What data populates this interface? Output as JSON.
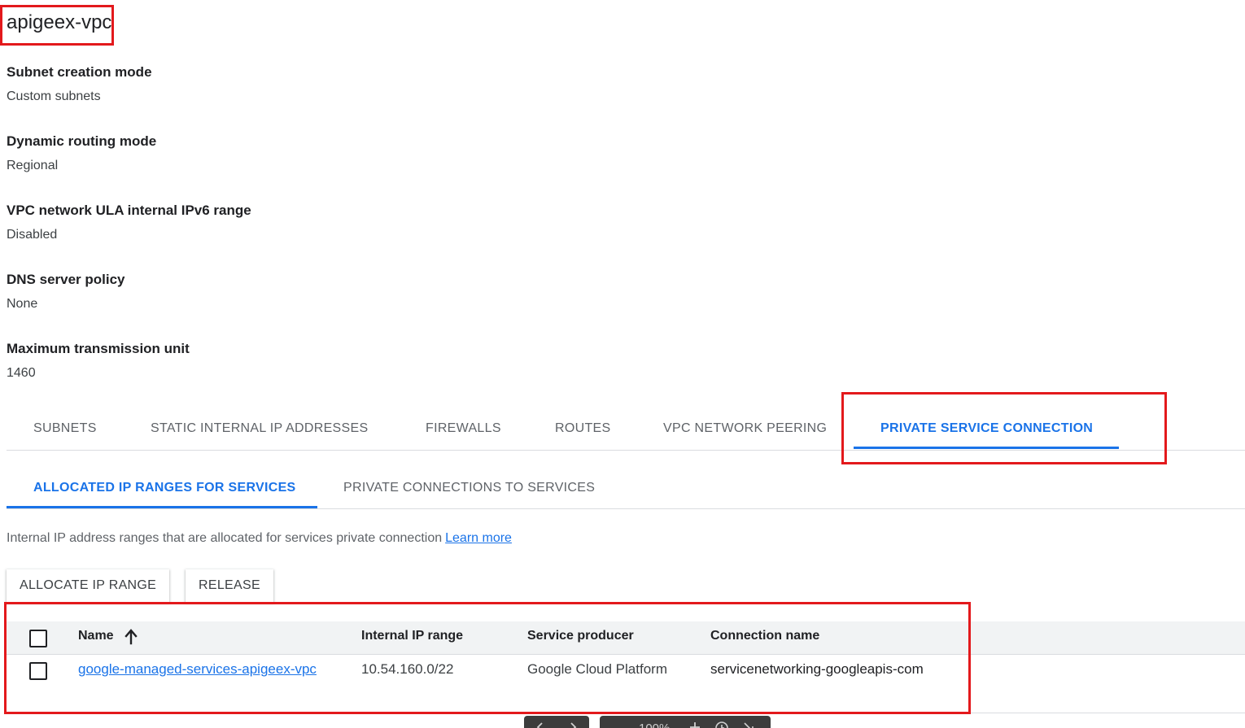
{
  "title": "apigeex-vpc",
  "properties": [
    {
      "label": "Subnet creation mode",
      "value": "Custom subnets"
    },
    {
      "label": "Dynamic routing mode",
      "value": "Regional"
    },
    {
      "label": "VPC network ULA internal IPv6 range",
      "value": "Disabled"
    },
    {
      "label": "DNS server policy",
      "value": "None"
    },
    {
      "label": "Maximum transmission unit",
      "value": "1460"
    }
  ],
  "tabs": [
    {
      "label": "SUBNETS"
    },
    {
      "label": "STATIC INTERNAL IP ADDRESSES"
    },
    {
      "label": "FIREWALLS"
    },
    {
      "label": "ROUTES"
    },
    {
      "label": "VPC NETWORK PEERING"
    },
    {
      "label": "PRIVATE SERVICE CONNECTION",
      "active": true
    }
  ],
  "subtabs": [
    {
      "label": "ALLOCATED IP RANGES FOR SERVICES",
      "active": true
    },
    {
      "label": "PRIVATE CONNECTIONS TO SERVICES"
    }
  ],
  "description": {
    "text": "Internal IP address ranges that are allocated for services private connection",
    "link": "Learn more"
  },
  "actions": {
    "allocate": "ALLOCATE IP RANGE",
    "release": "RELEASE"
  },
  "table": {
    "columns": [
      "Name",
      "Internal IP range",
      "Service producer",
      "Connection name"
    ],
    "sort_column": "Name",
    "sort_direction": "ascending",
    "rows": [
      {
        "name": "google-managed-services-apigeex-vpc",
        "ip_range": "10.54.160.0/22",
        "producer": "Google Cloud Platform",
        "connection": "servicenetworking-googleapis-com"
      }
    ]
  },
  "viewer": {
    "prev_icon": "chevron-left-icon",
    "next_icon": "chevron-right-icon",
    "zoom": "100%",
    "zoom_in_icon": "plus-icon",
    "reset_icon": "zoom-reset-icon",
    "expand_icon": "expand-icon"
  },
  "colors": {
    "accent": "#1a73e8",
    "highlight": "#e3191c"
  }
}
